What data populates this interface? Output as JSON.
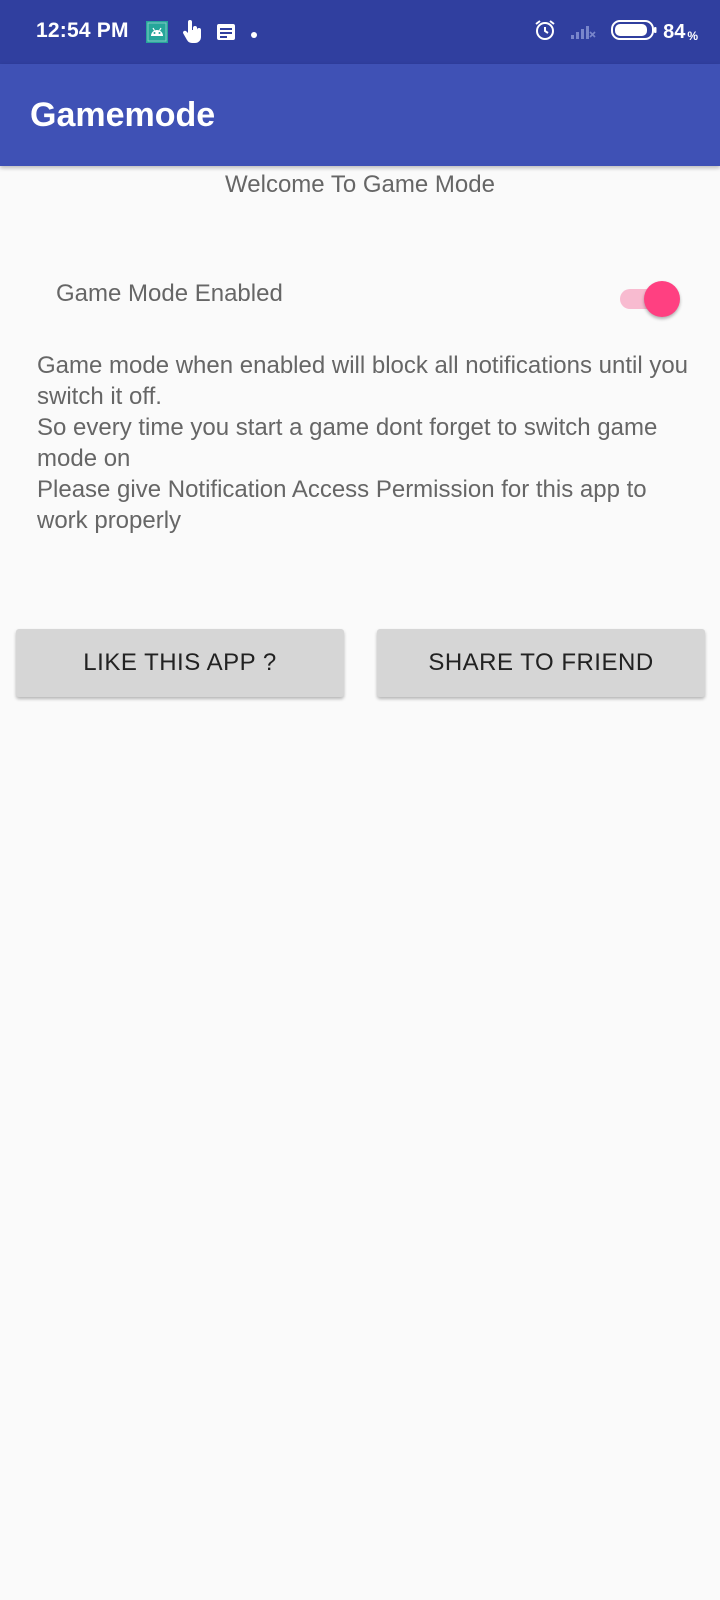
{
  "status_bar": {
    "time": "12:54 PM",
    "battery_level": "84",
    "battery_unit": "%",
    "icons_left": [
      "android-debug-icon",
      "hand-pointer-icon",
      "note-icon",
      "dot-icon"
    ],
    "icons_right": [
      "alarm-icon",
      "signal-off-icon",
      "battery-icon"
    ]
  },
  "app_bar": {
    "title": "Gamemode"
  },
  "main": {
    "welcome": "Welcome To Game Mode",
    "toggle_label": "Game Mode Enabled",
    "toggle_on": true,
    "description_lines": [
      "Game mode when enabled will block all notifications until you switch it off.",
      "So every time you start a game dont forget to switch game mode on",
      "Please give Notification Access Permission for this app to work properly"
    ],
    "like_button": "LIKE THIS APP ?",
    "share_button": "SHARE TO FRIEND"
  },
  "colors": {
    "status_bar": "#303f9f",
    "app_bar": "#3f51b5",
    "accent": "#ff4081",
    "background": "#fafafa",
    "button": "#d6d6d6"
  }
}
